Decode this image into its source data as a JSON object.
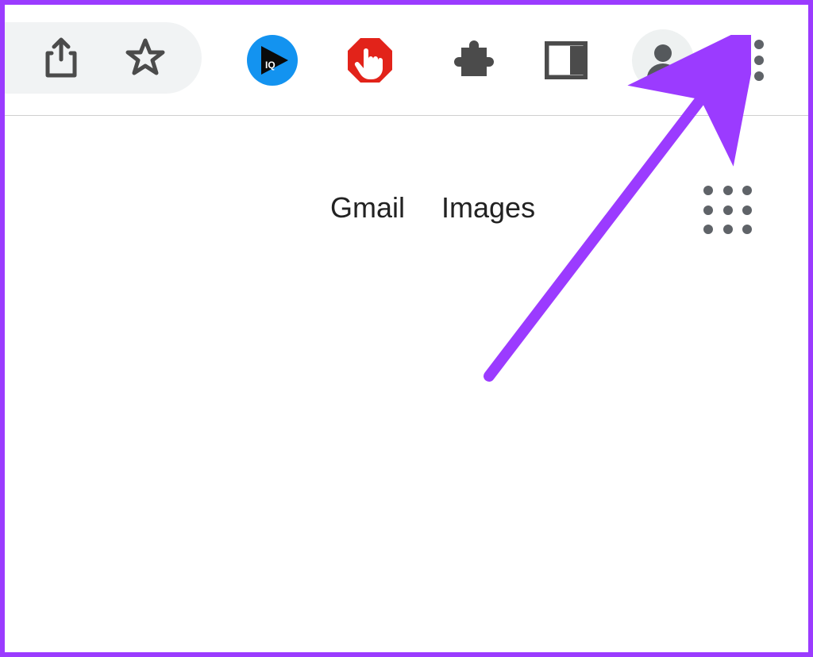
{
  "toolbar": {
    "share_icon": "share-icon",
    "bookmark_icon": "star-icon",
    "extensions": {
      "iq_icon": "iq-extension-icon",
      "adblock_icon": "adblock-hand-icon",
      "extensions_icon": "puzzle-piece-icon",
      "sidepanel_icon": "side-panel-icon"
    },
    "profile_icon": "profile-avatar-icon",
    "menu_icon": "three-dot-menu-icon"
  },
  "page": {
    "links": {
      "gmail": "Gmail",
      "images": "Images"
    },
    "apps_icon": "apps-grid-icon"
  },
  "annotation": {
    "arrow_color": "#9b3bff",
    "arrow_target": "three-dot-menu-icon"
  }
}
